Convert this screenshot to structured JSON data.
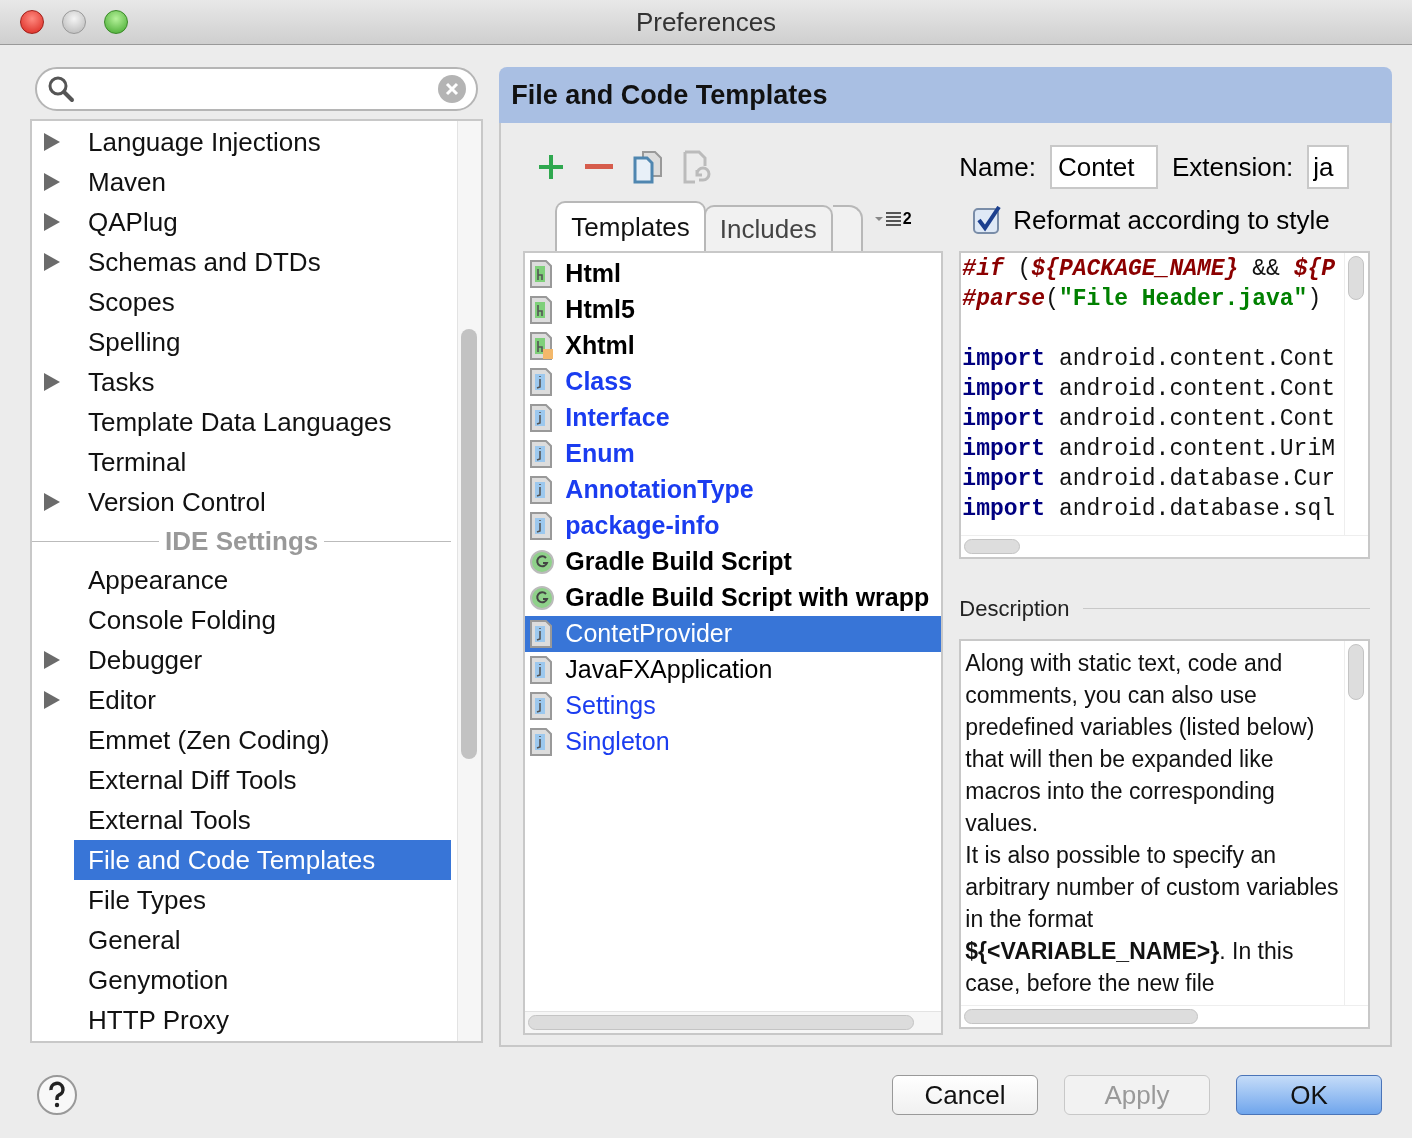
{
  "window": {
    "title": "Preferences"
  },
  "sidebar": {
    "items": [
      {
        "kind": "item",
        "label": "Language Injections",
        "expandable": true,
        "selected": false
      },
      {
        "kind": "item",
        "label": "Maven",
        "expandable": true,
        "selected": false
      },
      {
        "kind": "item",
        "label": "QAPlug",
        "expandable": true,
        "selected": false
      },
      {
        "kind": "item",
        "label": "Schemas and DTDs",
        "expandable": true,
        "selected": false
      },
      {
        "kind": "item",
        "label": "Scopes",
        "expandable": false,
        "selected": false
      },
      {
        "kind": "item",
        "label": "Spelling",
        "expandable": false,
        "selected": false
      },
      {
        "kind": "item",
        "label": "Tasks",
        "expandable": true,
        "selected": false
      },
      {
        "kind": "item",
        "label": "Template Data Languages",
        "expandable": false,
        "selected": false
      },
      {
        "kind": "item",
        "label": "Terminal",
        "expandable": false,
        "selected": false
      },
      {
        "kind": "item",
        "label": "Version Control",
        "expandable": true,
        "selected": false
      },
      {
        "kind": "header",
        "label": "IDE Settings"
      },
      {
        "kind": "item",
        "label": "Appearance",
        "expandable": false,
        "selected": false
      },
      {
        "kind": "item",
        "label": "Console Folding",
        "expandable": false,
        "selected": false
      },
      {
        "kind": "item",
        "label": "Debugger",
        "expandable": true,
        "selected": false
      },
      {
        "kind": "item",
        "label": "Editor",
        "expandable": true,
        "selected": false
      },
      {
        "kind": "item",
        "label": "Emmet (Zen Coding)",
        "expandable": false,
        "selected": false
      },
      {
        "kind": "item",
        "label": "External Diff Tools",
        "expandable": false,
        "selected": false
      },
      {
        "kind": "item",
        "label": "External Tools",
        "expandable": false,
        "selected": false
      },
      {
        "kind": "item",
        "label": "File and Code Templates",
        "expandable": false,
        "selected": true
      },
      {
        "kind": "item",
        "label": "File Types",
        "expandable": false,
        "selected": false
      },
      {
        "kind": "item",
        "label": "General",
        "expandable": false,
        "selected": false
      },
      {
        "kind": "item",
        "label": "Genymotion",
        "expandable": false,
        "selected": false
      },
      {
        "kind": "item",
        "label": "HTTP Proxy",
        "expandable": false,
        "selected": false
      }
    ]
  },
  "panel": {
    "title": "File and Code Templates",
    "tabs": [
      {
        "label": "Templates",
        "selected": true
      },
      {
        "label": "Includes",
        "selected": false
      }
    ],
    "tab_overflow": "2",
    "templates": [
      {
        "label": "Html",
        "kind": "html",
        "bold": true,
        "color": "#000000",
        "selected": false
      },
      {
        "label": "Html5",
        "kind": "html",
        "bold": true,
        "color": "#000000",
        "selected": false
      },
      {
        "label": "Xhtml",
        "kind": "xhtml",
        "bold": true,
        "color": "#000000",
        "selected": false
      },
      {
        "label": "Class",
        "kind": "java",
        "bold": true,
        "color": "#1a3cf0",
        "selected": false
      },
      {
        "label": "Interface",
        "kind": "java",
        "bold": true,
        "color": "#1a3cf0",
        "selected": false
      },
      {
        "label": "Enum",
        "kind": "java",
        "bold": true,
        "color": "#1a3cf0",
        "selected": false
      },
      {
        "label": "AnnotationType",
        "kind": "java",
        "bold": true,
        "color": "#1a3cf0",
        "selected": false
      },
      {
        "label": "package-info",
        "kind": "java",
        "bold": true,
        "color": "#1a3cf0",
        "selected": false
      },
      {
        "label": "Gradle Build Script",
        "kind": "gradle",
        "bold": true,
        "color": "#000000",
        "selected": false
      },
      {
        "label": "Gradle Build Script with wrapp",
        "kind": "gradle",
        "bold": true,
        "color": "#000000",
        "selected": false
      },
      {
        "label": "ContetProvider",
        "kind": "java",
        "bold": false,
        "selected": true
      },
      {
        "label": "JavaFXApplication",
        "kind": "java",
        "bold": false,
        "color": "#000000",
        "selected": false
      },
      {
        "label": "Settings",
        "kind": "java",
        "bold": false,
        "color": "#1a3cf0",
        "selected": false
      },
      {
        "label": "Singleton",
        "kind": "java",
        "bold": false,
        "color": "#1a3cf0",
        "selected": false
      }
    ],
    "name_label": "Name:",
    "name_value": "Contet",
    "extension_label": "Extension:",
    "extension_value": "ja",
    "reformat": {
      "label": "Reformat according to style",
      "checked": true
    },
    "code": [
      {
        "kind": "line",
        "segments": [
          {
            "kind": "directive",
            "text": "#if"
          },
          {
            "kind": "plain",
            "text": " ("
          },
          {
            "kind": "variable",
            "text": "${PACKAGE_NAME}"
          },
          {
            "kind": "plain",
            "text": " && "
          },
          {
            "kind": "variable",
            "text": "${P"
          }
        ]
      },
      {
        "kind": "line",
        "segments": [
          {
            "kind": "directive",
            "text": "#parse"
          },
          {
            "kind": "plain",
            "text": "("
          },
          {
            "kind": "string",
            "text": "\"File Header.java\""
          },
          {
            "kind": "plain",
            "text": ")"
          }
        ]
      },
      {
        "kind": "blank"
      },
      {
        "kind": "line",
        "segments": [
          {
            "kind": "keyword",
            "text": "import"
          },
          {
            "kind": "plain",
            "text": " android.content.Cont"
          }
        ]
      },
      {
        "kind": "line",
        "segments": [
          {
            "kind": "keyword",
            "text": "import"
          },
          {
            "kind": "plain",
            "text": " android.content.Cont"
          }
        ]
      },
      {
        "kind": "line",
        "segments": [
          {
            "kind": "keyword",
            "text": "import"
          },
          {
            "kind": "plain",
            "text": " android.content.Cont"
          }
        ]
      },
      {
        "kind": "line",
        "segments": [
          {
            "kind": "keyword",
            "text": "import"
          },
          {
            "kind": "plain",
            "text": " android.content.UriM"
          }
        ]
      },
      {
        "kind": "line",
        "segments": [
          {
            "kind": "keyword",
            "text": "import"
          },
          {
            "kind": "plain",
            "text": " android.database.Cur"
          }
        ]
      },
      {
        "kind": "line",
        "segments": [
          {
            "kind": "keyword",
            "text": "import"
          },
          {
            "kind": "plain",
            "text": " android.database.sql"
          }
        ]
      }
    ],
    "description_label": "Description",
    "description": [
      "Along with static text, code and comments, you can also use predefined variables (listed below) that will then be expanded like macros into the corresponding values.",
      "It is also possible to specify an arbitrary number of custom variables in the format **${<VARIABLE_NAME>}**. In this case, before the new file"
    ]
  },
  "buttons": [
    {
      "label": "Cancel",
      "kind": "normal"
    },
    {
      "label": "Apply",
      "kind": "disabled"
    },
    {
      "label": "OK",
      "kind": "default"
    }
  ]
}
